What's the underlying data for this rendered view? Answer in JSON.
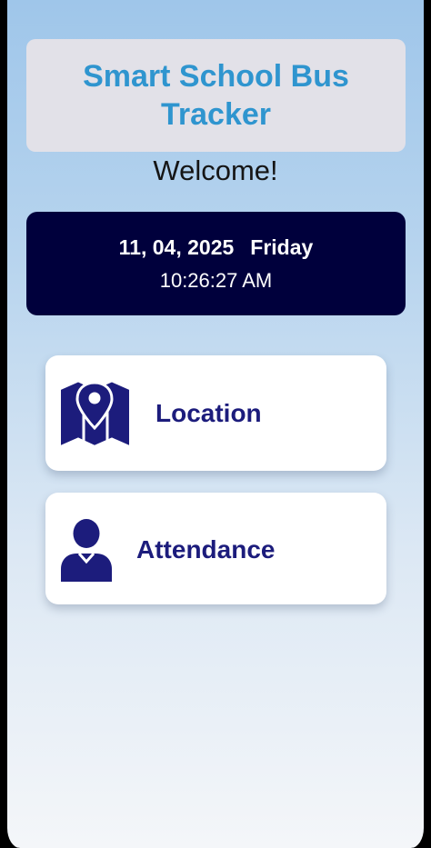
{
  "app": {
    "title": "Smart School Bus Tracker",
    "welcome": "Welcome!"
  },
  "datetime": {
    "date": "11, 04, 2025",
    "weekday": "Friday",
    "time": "10:26:27 AM"
  },
  "menu": [
    {
      "label": "Location",
      "icon": "map-location-icon"
    },
    {
      "label": "Attendance",
      "icon": "person-icon"
    }
  ],
  "colors": {
    "title_text": "#2f95cf",
    "datetime_bg": "#00003c",
    "menu_label": "#1c1c7c",
    "icon": "#1c1c7c"
  }
}
